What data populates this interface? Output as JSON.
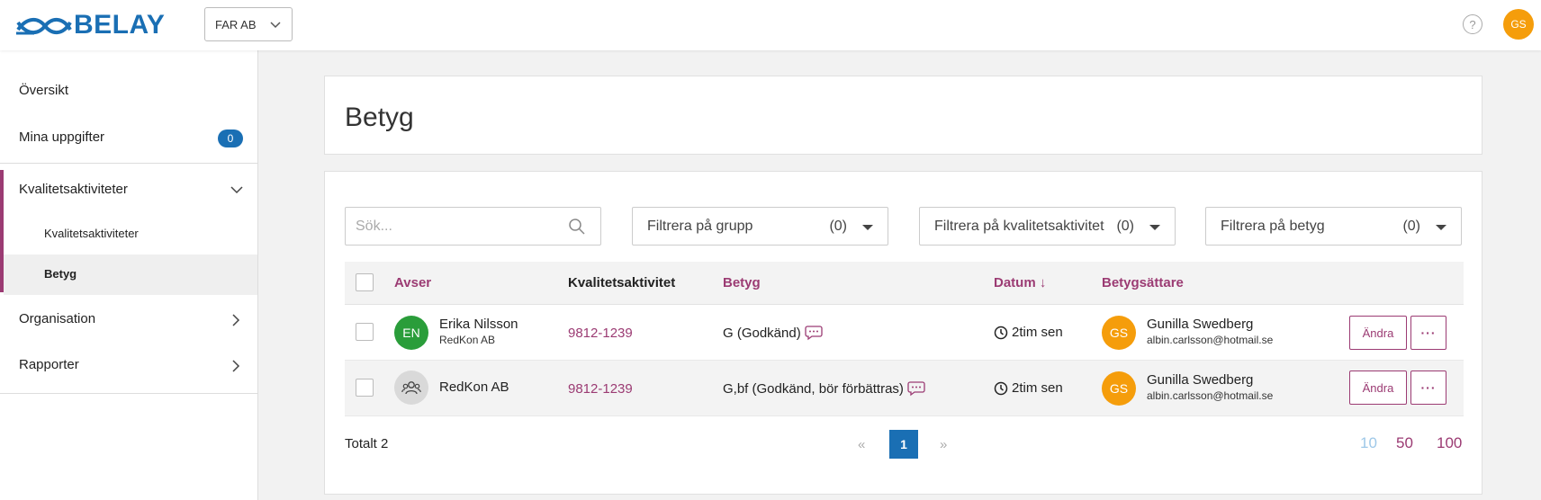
{
  "app": {
    "logo_text": "BELAY",
    "org": "FAR AB",
    "user_initials": "GS",
    "help_glyph": "?"
  },
  "colors": {
    "brand_blue": "#1a6fb4",
    "accent": "#9b3b73",
    "avatar_orange": "#f59d0b",
    "avatar_green": "#2a9d3a"
  },
  "sidebar": {
    "overview": "Översikt",
    "tasks": {
      "label": "Mina uppgifter",
      "badge": "0"
    },
    "quality": {
      "label": "Kvalitetsaktiviteter",
      "sub": [
        "Kvalitetsaktiviteter",
        "Betyg"
      ]
    },
    "organisation": "Organisation",
    "reports": "Rapporter"
  },
  "page": {
    "title": "Betyg"
  },
  "search": {
    "placeholder": "Sök..."
  },
  "filters": [
    {
      "label": "Filtrera på grupp",
      "count": "(0)"
    },
    {
      "label": "Filtrera på kvalitetsaktivitet",
      "count": "(0)"
    },
    {
      "label": "Filtrera på betyg",
      "count": "(0)"
    }
  ],
  "table": {
    "headers": {
      "subject": "Avser",
      "activity": "Kvalitetsaktivitet",
      "grade": "Betyg",
      "date": "Datum ↓",
      "grader": "Betygsättare"
    },
    "rows": [
      {
        "initials": "EN",
        "name": "Erika Nilsson",
        "org": "RedKon AB",
        "activity": "9812-1239",
        "grade": "G (Godkänd)",
        "date": "2tim sen",
        "grader_initials": "GS",
        "grader_name": "Gunilla Swedberg",
        "grader_email": "albin.carlsson@hotmail.se",
        "edit": "Ändra",
        "more": "···"
      },
      {
        "initials": "",
        "name": "RedKon AB",
        "org": "",
        "activity": "9812-1239",
        "grade": "G,bf (Godkänd, bör förbättras)",
        "date": "2tim sen",
        "grader_initials": "GS",
        "grader_name": "Gunilla Swedberg",
        "grader_email": "albin.carlsson@hotmail.se",
        "edit": "Ändra",
        "more": "···"
      }
    ]
  },
  "footer": {
    "total": "Totalt 2",
    "prev": "«",
    "page": "1",
    "next": "»",
    "page_sizes": [
      "10",
      "50",
      "100"
    ]
  }
}
